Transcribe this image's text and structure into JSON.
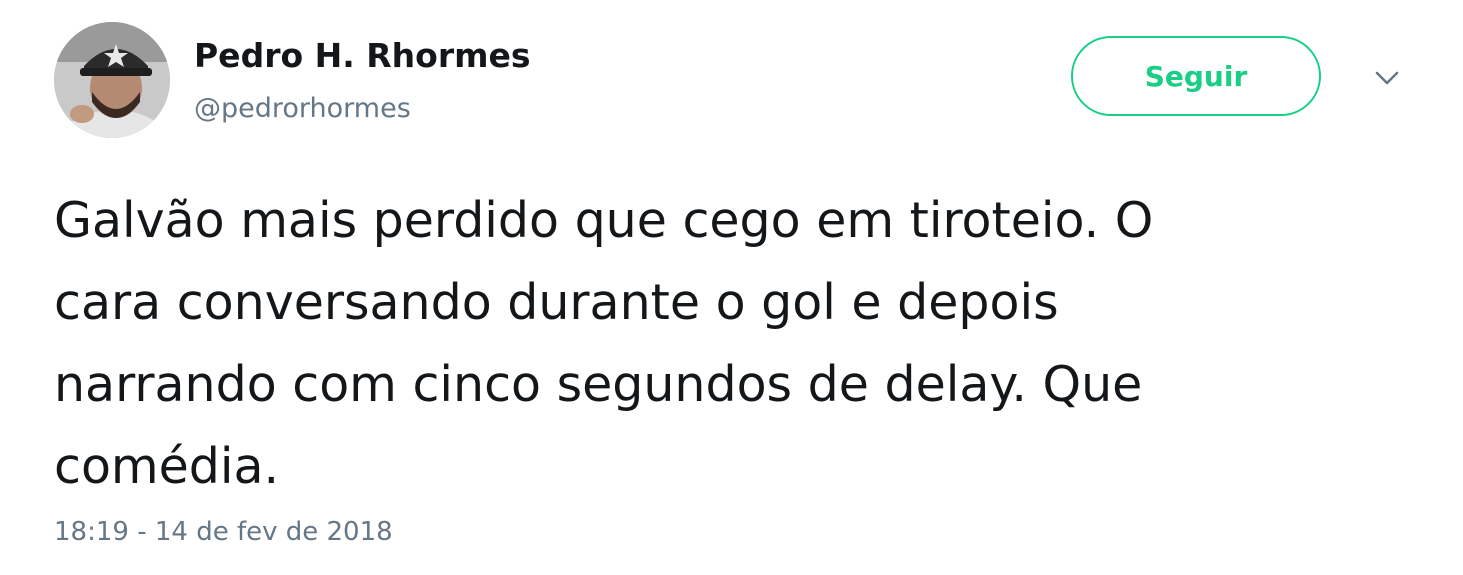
{
  "author": {
    "display_name": "Pedro H. Rhormes",
    "handle": "@pedrorhormes"
  },
  "follow_button": {
    "label": "Seguir"
  },
  "tweet": {
    "text": "Galvão mais perdido que cego em tiroteio. O\ncara conversando durante o gol e depois\nnarrando com cinco segundos de delay. Que\ncomédia.",
    "timestamp": "18:19 - 14 de fev de 2018"
  },
  "icons": {
    "more_menu": "chevron-down-icon"
  },
  "colors": {
    "accent": "#19cf86",
    "text_primary": "#14171a",
    "text_secondary": "#657786"
  }
}
